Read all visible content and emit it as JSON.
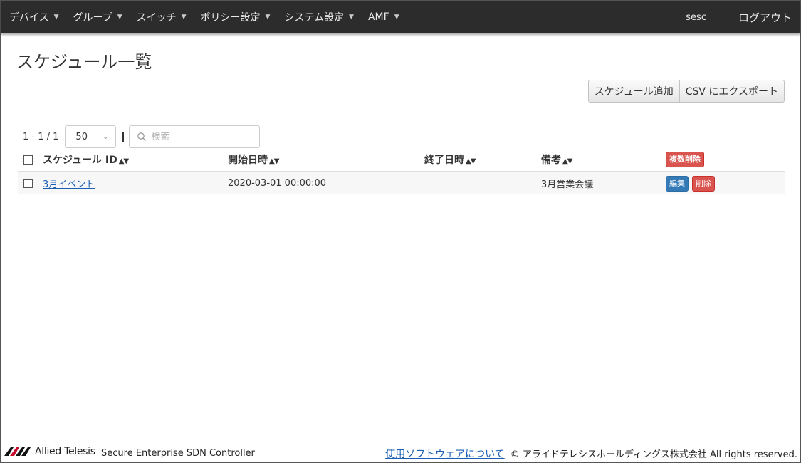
{
  "nav": {
    "items": [
      {
        "label": "デバイス"
      },
      {
        "label": "グループ"
      },
      {
        "label": "スイッチ"
      },
      {
        "label": "ポリシー設定"
      },
      {
        "label": "システム設定"
      },
      {
        "label": "AMF"
      }
    ],
    "caret_icon": "chevron-down-icon",
    "user": "sesc",
    "logout": "ログアウト",
    "background_color": "#2c2c2c"
  },
  "page": {
    "title": "スケジュール一覧",
    "add_button": "スケジュール追加",
    "export_button": "CSV にエクスポート"
  },
  "toolbar": {
    "pager_info": "1 - 1 / 1",
    "per_page": "50",
    "search_placeholder": "検索"
  },
  "table": {
    "columns": [
      "スケジュール ID",
      "開始日時",
      "終了日時",
      "備考"
    ],
    "bulk_delete": "複数削除",
    "rows": [
      {
        "id": "3月イベント",
        "start": "2020-03-01 00:00:00",
        "end": "",
        "note": "3月営業会議",
        "edit": "編集",
        "delete": "削除"
      }
    ],
    "colors": {
      "primary": "#337ab7",
      "danger": "#d9534f",
      "link": "#1a5fb4"
    }
  },
  "footer": {
    "logo_text": "Allied Telesis",
    "product": "Secure Enterprise SDN Controller",
    "software_link": "使用ソフトウェアについて",
    "copyright": "© アライドテレシスホールディングス株式会社 All rights reserved."
  }
}
